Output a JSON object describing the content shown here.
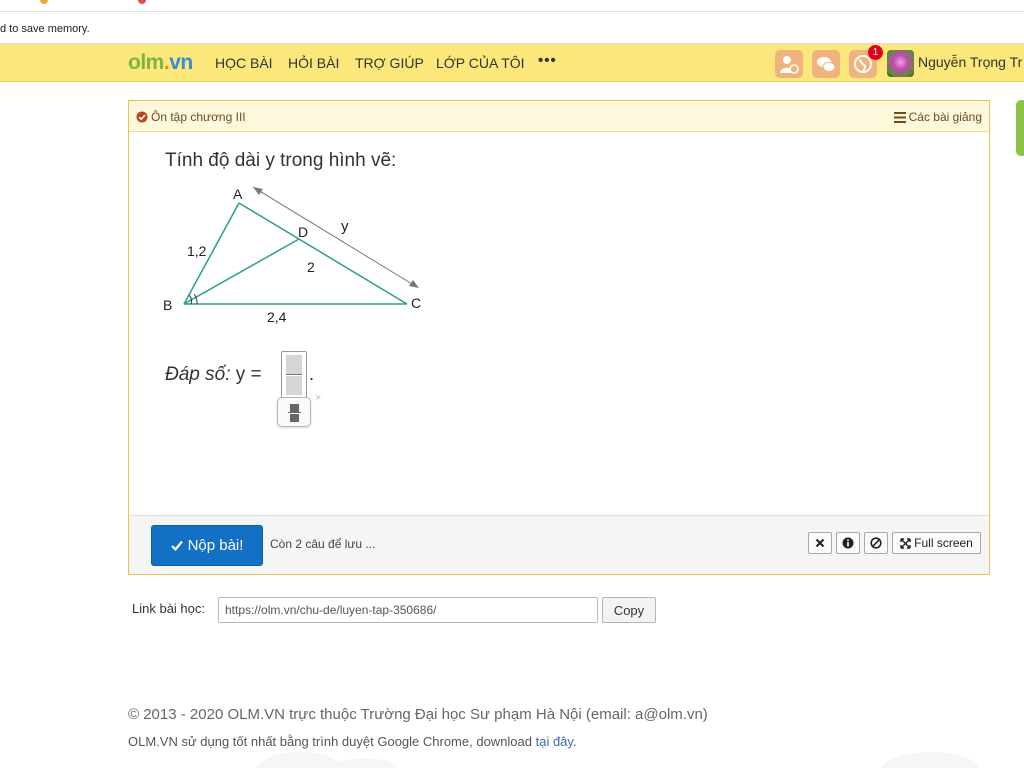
{
  "browser": {
    "infobar_text": "d to save memory."
  },
  "header": {
    "logo_parts": [
      "olm",
      ".",
      "vn"
    ],
    "nav_items": [
      "HỌC BÀI",
      "HỎI BÀI",
      "TRỢ GIÚP",
      "LỚP CỦA TÔI"
    ],
    "more_label": "•••",
    "notification_count": "1",
    "user_name": "Nguyễn Trọng Tr"
  },
  "panel": {
    "topic_title": "Ôn tập chương III",
    "lessons_link": "Các bài giảng",
    "question": "Tính độ dài y trong hình vẽ:",
    "figure": {
      "points": [
        "A",
        "B",
        "C",
        "D"
      ],
      "length_labels": [
        "1,2",
        "2",
        "2,4",
        "y"
      ]
    },
    "answer_label": "Đáp số:",
    "answer_equation": " y = ",
    "answer_end": ".",
    "close_glyph": "×",
    "submit_label": "Nộp bài!",
    "save_status": "Còn 2 câu để lưu ...",
    "fullscreen_label": "Full screen"
  },
  "link_row": {
    "label": "Link bài học:",
    "url": "https://olm.vn/chu-de/luyen-tap-350686/",
    "copy_label": "Copy"
  },
  "footer": {
    "copyright": "© 2013 - 2020 OLM.VN trực thuộc Trường Đại học Sư phạm Hà Nội (email: a@olm.vn)",
    "browser_note": "OLM.VN sử dụng tốt nhất bằng trình duyệt Google Chrome, download ",
    "download_link": "tại đây",
    "browser_note_end": "."
  },
  "colors": {
    "navbar": "#fbe77a",
    "panel_border": "#e8c54a",
    "submit_button": "#1271c4",
    "triangle": "#2a9d8f",
    "arrow": "#777777"
  }
}
